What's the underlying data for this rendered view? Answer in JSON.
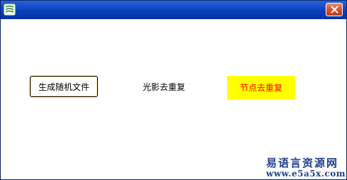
{
  "window": {
    "title_icon": "app-icon",
    "close_icon": "close-icon",
    "colors": {
      "titlebar": "#0a3fb8",
      "close": "#d8502c"
    }
  },
  "buttons": {
    "generate_label": "生成随机文件",
    "light_shadow_label": "光影去重复",
    "node_label": "节点去重复"
  },
  "colors": {
    "node_button_bg": "#ffff00",
    "node_button_text": "#ff0000",
    "watermark": "#1f3f8f"
  },
  "watermark": {
    "site_name": "易语言资源网",
    "url": "www.e5a5x.com"
  }
}
